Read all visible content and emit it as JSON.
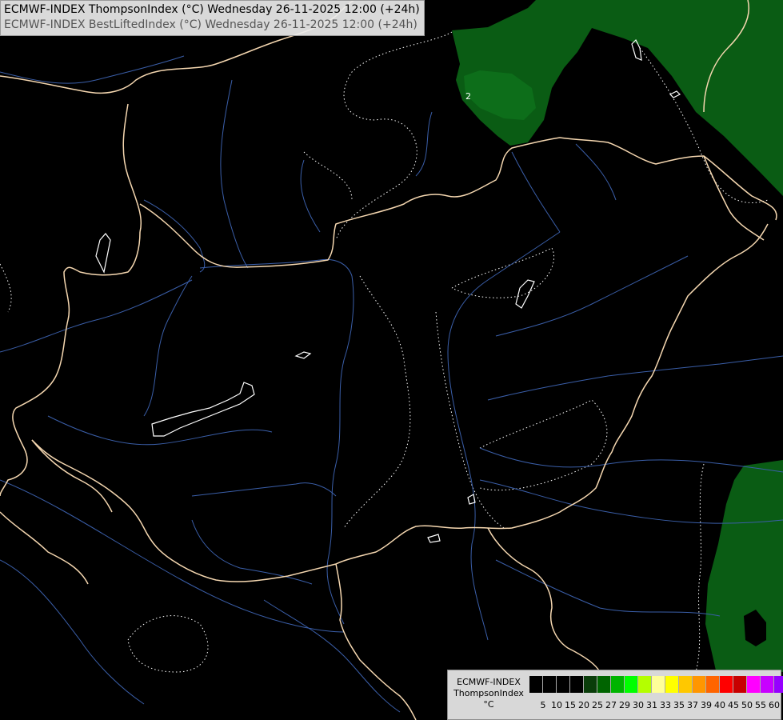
{
  "header": {
    "line1": "ECMWF-INDEX ThompsonIndex (°C) Wednesday 26-11-2025 12:00 (+24h)",
    "line2": "ECMWF-INDEX BestLiftedIndex (°C) Wednesday 26-11-2025 12:00 (+24h)"
  },
  "map": {
    "contour_label": "2",
    "colors": {
      "background": "#000000",
      "border": "#f5d7b0",
      "river": "#3a5ea8",
      "contour": "#ffffff",
      "fill_green": "#006400"
    }
  },
  "legend": {
    "title_line1": "ECMWF-INDEX",
    "title_line2": "ThompsonIndex",
    "unit": "°C",
    "colors": [
      "#000000",
      "#000000",
      "#000000",
      "#000000",
      "#0a3d0a",
      "#006400",
      "#00b400",
      "#00ff00",
      "#b4ff00",
      "#ffff99",
      "#ffff00",
      "#ffc800",
      "#ff9600",
      "#ff6400",
      "#ff0000",
      "#c80000",
      "#ff00ff",
      "#c800ff",
      "#9600ff",
      "#6400ff",
      "#0000ff"
    ],
    "ticks": [
      "5",
      "10",
      "15",
      "20",
      "25",
      "27",
      "29",
      "30",
      "31",
      "33",
      "35",
      "37",
      "39",
      "40",
      "45",
      "50",
      "55",
      "60"
    ]
  }
}
